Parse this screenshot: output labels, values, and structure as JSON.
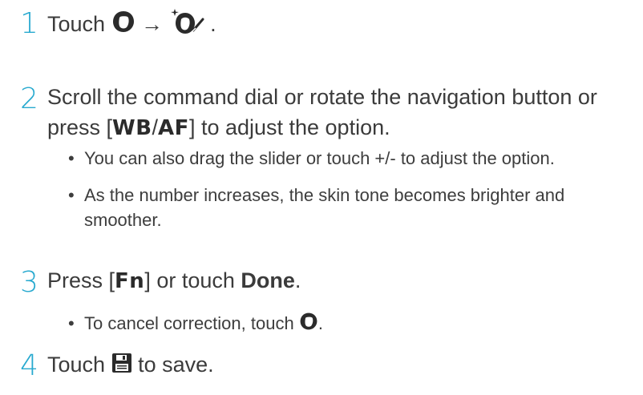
{
  "steps": [
    {
      "num": "1",
      "pre": "Touch",
      "arrow": "→",
      "post": "."
    },
    {
      "num": "2",
      "line1": "Scroll the command dial or rotate the navigation button or",
      "line2_pre": "press [",
      "key_wb": "WB",
      "slash": "/",
      "key_af": "AF",
      "line2_post": "] to adjust the option.",
      "bullets": [
        "You can also drag the slider or touch +/- to adjust the option.",
        "As the number increases, the skin tone becomes brighter and smoother."
      ]
    },
    {
      "num": "3",
      "pre": "Press [",
      "key": "Fn",
      "mid": "] or touch ",
      "bold": "Done",
      "post": ".",
      "bullet_pre": "To cancel correction, touch",
      "bullet_post": "."
    },
    {
      "num": "4",
      "pre": "Touch",
      "post": "to save."
    }
  ],
  "bullet_symbol": "•",
  "icons": {
    "face": "face-retouch-icon",
    "beauty": "beauty-sparkle-icon",
    "save": "save-disk-icon"
  },
  "colors": {
    "step_number": "#27a9cf",
    "text": "#3b3b3b"
  }
}
